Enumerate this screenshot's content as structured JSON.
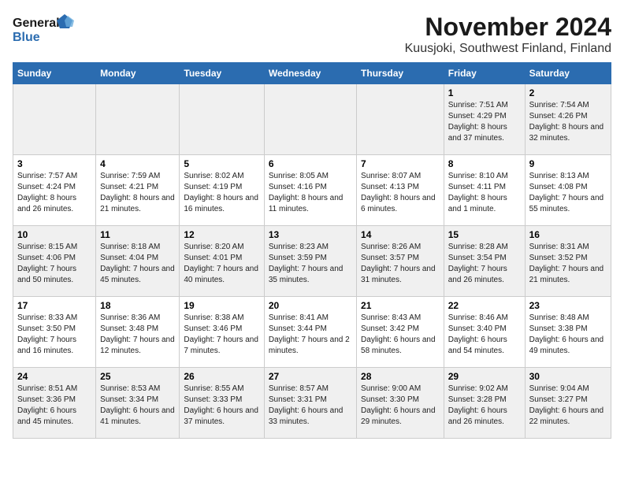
{
  "header": {
    "logo_line1": "General",
    "logo_line2": "Blue",
    "main_title": "November 2024",
    "subtitle": "Kuusjoki, Southwest Finland, Finland"
  },
  "weekdays": [
    "Sunday",
    "Monday",
    "Tuesday",
    "Wednesday",
    "Thursday",
    "Friday",
    "Saturday"
  ],
  "weeks": [
    [
      {
        "day": "",
        "info": ""
      },
      {
        "day": "",
        "info": ""
      },
      {
        "day": "",
        "info": ""
      },
      {
        "day": "",
        "info": ""
      },
      {
        "day": "",
        "info": ""
      },
      {
        "day": "1",
        "info": "Sunrise: 7:51 AM\nSunset: 4:29 PM\nDaylight: 8 hours and 37 minutes."
      },
      {
        "day": "2",
        "info": "Sunrise: 7:54 AM\nSunset: 4:26 PM\nDaylight: 8 hours and 32 minutes."
      }
    ],
    [
      {
        "day": "3",
        "info": "Sunrise: 7:57 AM\nSunset: 4:24 PM\nDaylight: 8 hours and 26 minutes."
      },
      {
        "day": "4",
        "info": "Sunrise: 7:59 AM\nSunset: 4:21 PM\nDaylight: 8 hours and 21 minutes."
      },
      {
        "day": "5",
        "info": "Sunrise: 8:02 AM\nSunset: 4:19 PM\nDaylight: 8 hours and 16 minutes."
      },
      {
        "day": "6",
        "info": "Sunrise: 8:05 AM\nSunset: 4:16 PM\nDaylight: 8 hours and 11 minutes."
      },
      {
        "day": "7",
        "info": "Sunrise: 8:07 AM\nSunset: 4:13 PM\nDaylight: 8 hours and 6 minutes."
      },
      {
        "day": "8",
        "info": "Sunrise: 8:10 AM\nSunset: 4:11 PM\nDaylight: 8 hours and 1 minute."
      },
      {
        "day": "9",
        "info": "Sunrise: 8:13 AM\nSunset: 4:08 PM\nDaylight: 7 hours and 55 minutes."
      }
    ],
    [
      {
        "day": "10",
        "info": "Sunrise: 8:15 AM\nSunset: 4:06 PM\nDaylight: 7 hours and 50 minutes."
      },
      {
        "day": "11",
        "info": "Sunrise: 8:18 AM\nSunset: 4:04 PM\nDaylight: 7 hours and 45 minutes."
      },
      {
        "day": "12",
        "info": "Sunrise: 8:20 AM\nSunset: 4:01 PM\nDaylight: 7 hours and 40 minutes."
      },
      {
        "day": "13",
        "info": "Sunrise: 8:23 AM\nSunset: 3:59 PM\nDaylight: 7 hours and 35 minutes."
      },
      {
        "day": "14",
        "info": "Sunrise: 8:26 AM\nSunset: 3:57 PM\nDaylight: 7 hours and 31 minutes."
      },
      {
        "day": "15",
        "info": "Sunrise: 8:28 AM\nSunset: 3:54 PM\nDaylight: 7 hours and 26 minutes."
      },
      {
        "day": "16",
        "info": "Sunrise: 8:31 AM\nSunset: 3:52 PM\nDaylight: 7 hours and 21 minutes."
      }
    ],
    [
      {
        "day": "17",
        "info": "Sunrise: 8:33 AM\nSunset: 3:50 PM\nDaylight: 7 hours and 16 minutes."
      },
      {
        "day": "18",
        "info": "Sunrise: 8:36 AM\nSunset: 3:48 PM\nDaylight: 7 hours and 12 minutes."
      },
      {
        "day": "19",
        "info": "Sunrise: 8:38 AM\nSunset: 3:46 PM\nDaylight: 7 hours and 7 minutes."
      },
      {
        "day": "20",
        "info": "Sunrise: 8:41 AM\nSunset: 3:44 PM\nDaylight: 7 hours and 2 minutes."
      },
      {
        "day": "21",
        "info": "Sunrise: 8:43 AM\nSunset: 3:42 PM\nDaylight: 6 hours and 58 minutes."
      },
      {
        "day": "22",
        "info": "Sunrise: 8:46 AM\nSunset: 3:40 PM\nDaylight: 6 hours and 54 minutes."
      },
      {
        "day": "23",
        "info": "Sunrise: 8:48 AM\nSunset: 3:38 PM\nDaylight: 6 hours and 49 minutes."
      }
    ],
    [
      {
        "day": "24",
        "info": "Sunrise: 8:51 AM\nSunset: 3:36 PM\nDaylight: 6 hours and 45 minutes."
      },
      {
        "day": "25",
        "info": "Sunrise: 8:53 AM\nSunset: 3:34 PM\nDaylight: 6 hours and 41 minutes."
      },
      {
        "day": "26",
        "info": "Sunrise: 8:55 AM\nSunset: 3:33 PM\nDaylight: 6 hours and 37 minutes."
      },
      {
        "day": "27",
        "info": "Sunrise: 8:57 AM\nSunset: 3:31 PM\nDaylight: 6 hours and 33 minutes."
      },
      {
        "day": "28",
        "info": "Sunrise: 9:00 AM\nSunset: 3:30 PM\nDaylight: 6 hours and 29 minutes."
      },
      {
        "day": "29",
        "info": "Sunrise: 9:02 AM\nSunset: 3:28 PM\nDaylight: 6 hours and 26 minutes."
      },
      {
        "day": "30",
        "info": "Sunrise: 9:04 AM\nSunset: 3:27 PM\nDaylight: 6 hours and 22 minutes."
      }
    ]
  ]
}
